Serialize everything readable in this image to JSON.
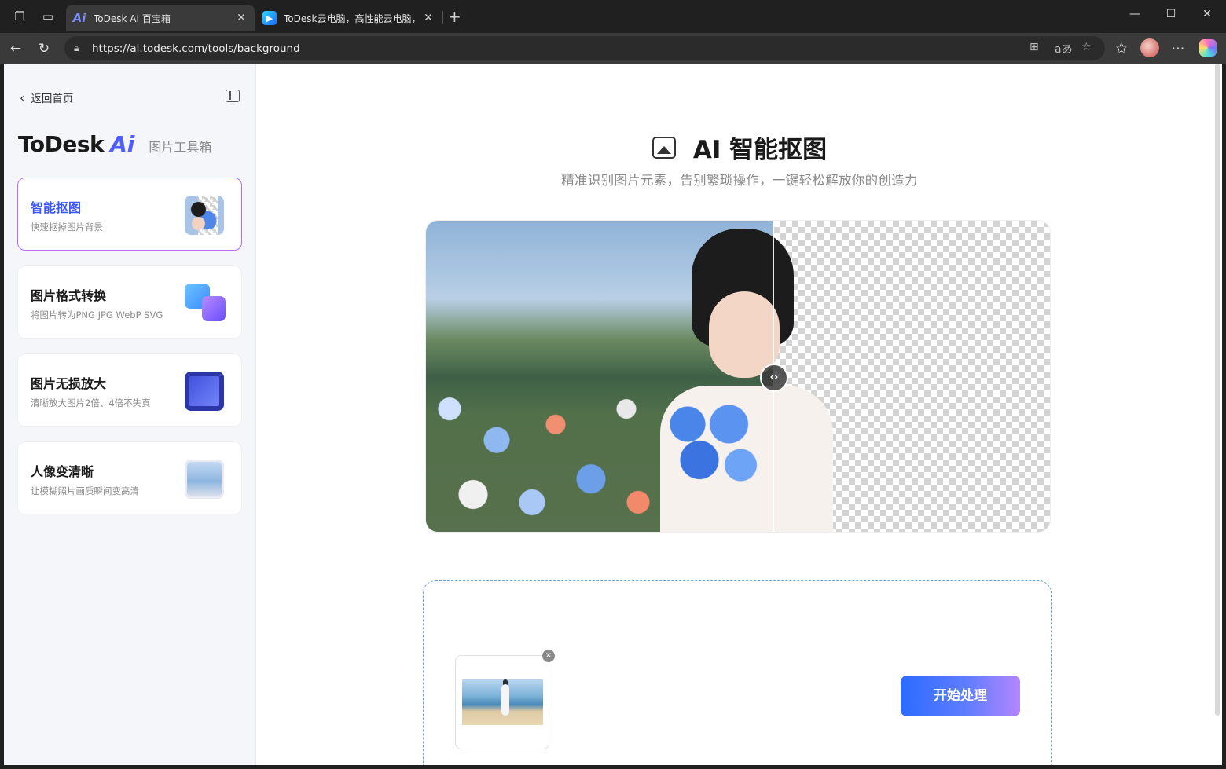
{
  "browser": {
    "tabs": [
      {
        "title": "ToDesk AI 百宝箱",
        "favicon": "todesk-ai-icon",
        "active": true
      },
      {
        "title": "ToDesk云电脑，高性能云电脑，云",
        "favicon": "todesk-cloud-icon",
        "active": false
      }
    ],
    "url": "https://ai.todesk.com/tools/background"
  },
  "sidebar": {
    "back_label": "返回首页",
    "brand": {
      "logo": "ToDesk",
      "logo_ai": "Ai",
      "subtitle": "图片工具箱"
    },
    "tools": [
      {
        "title": "智能抠图",
        "desc": "快速抠掉图片背景",
        "active": true,
        "icon": "cutout-thumb"
      },
      {
        "title": "图片格式转换",
        "desc": "将图片转为PNG JPG WebP SVG",
        "active": false,
        "icon": "format-convert-icon"
      },
      {
        "title": "图片无损放大",
        "desc": "清晰放大图片2倍、4倍不失真",
        "active": false,
        "icon": "upscale-thumb"
      },
      {
        "title": "人像变清晰",
        "desc": "让模糊照片画质瞬间变高清",
        "active": false,
        "icon": "portrait-enhance-thumb"
      }
    ]
  },
  "main": {
    "title": "AI 智能抠图",
    "subtitle": "精准识别图片元素，告别繁琐操作，一键轻松解放你的创造力",
    "compare": {
      "split_percent": 55.6
    },
    "upload": {
      "start_label": "开始处理",
      "remove_label": "×"
    }
  },
  "colors": {
    "accent": "#3a56ff",
    "active_border": "#b46cff",
    "button_start": "#2d6bff",
    "button_end": "#b386ff"
  }
}
